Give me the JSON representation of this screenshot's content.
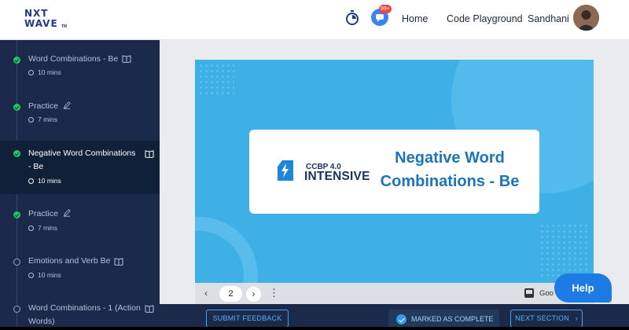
{
  "header": {
    "logo_line1": "NXT",
    "logo_line2": "WAVE",
    "logo_tm": "TM",
    "notification_badge": "99+",
    "nav_home": "Home",
    "nav_code_playground": "Code Playground",
    "user_name": "Sandhani"
  },
  "sidebar": {
    "items": [
      {
        "title": "Word Combinations - Be",
        "duration": "10 mins",
        "status": "done",
        "icon": "book-icon"
      },
      {
        "title": "Practice",
        "duration": "7 mins",
        "status": "done",
        "icon": "pencil-icon"
      },
      {
        "title_line1": "Negative Word Combinations",
        "title_line2": "- Be",
        "duration": "10 mins",
        "status": "done",
        "icon": "book-icon",
        "active": true
      },
      {
        "title": "Practice",
        "duration": "7 mins",
        "status": "done",
        "icon": "pencil-icon"
      },
      {
        "title": "Emotions and Verb Be",
        "duration": "10 mins",
        "status": "todo",
        "icon": "book-icon"
      },
      {
        "title_line1": "Word Combinations - 1 (Action",
        "title_line2": "Words)",
        "status": "todo",
        "icon": "book-icon"
      }
    ]
  },
  "slide": {
    "brand_version": "CCBP 4.0",
    "brand_name": "INTENSIVE",
    "title_line1": "Negative Word",
    "title_line2": "Combinations - Be",
    "current_page": "2",
    "viewer_label": "Goo"
  },
  "actions": {
    "help": "Help",
    "submit_feedback": "SUBMIT FEEDBACK",
    "marked_complete": "MARKED AS COMPLETE",
    "next_section": "NEXT SECTION"
  },
  "colors": {
    "sidebar_bg": "#1b2a4a",
    "slide_bg": "#3fb0e6",
    "accent": "#1d7be5",
    "done_green": "#22c55e"
  }
}
